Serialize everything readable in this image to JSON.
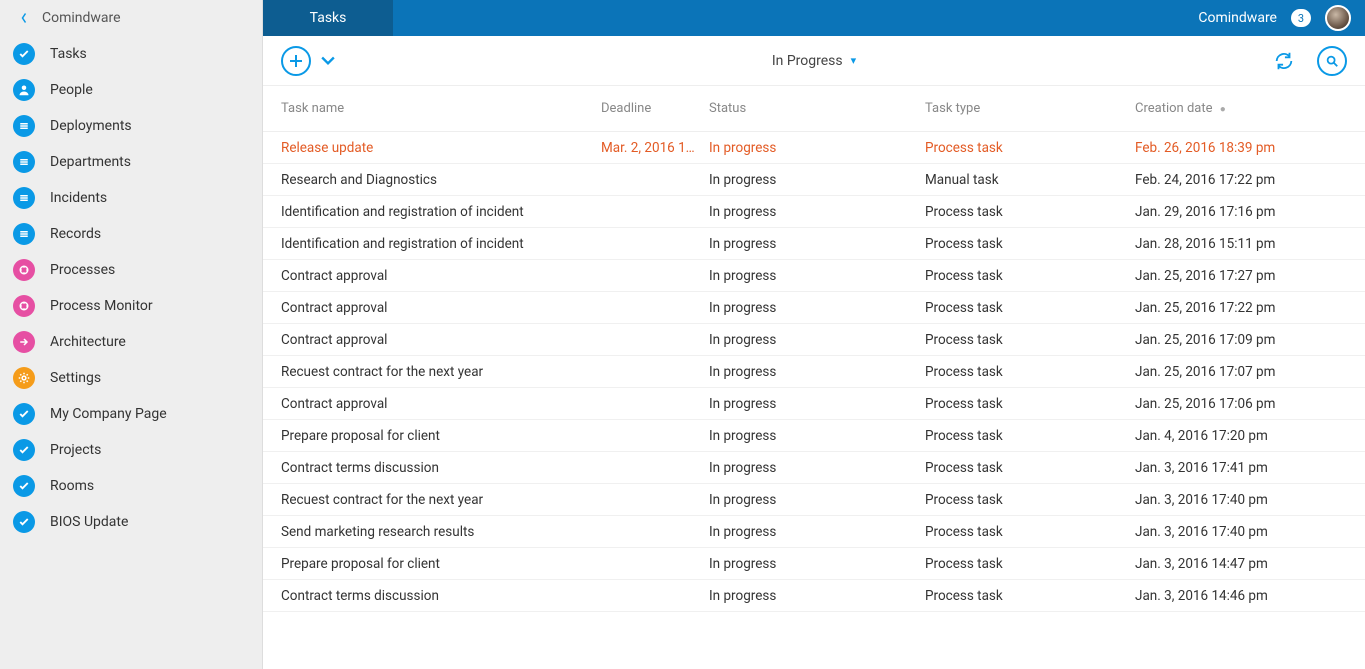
{
  "sidebar": {
    "back_label": "Comindware",
    "items": [
      {
        "label": "Tasks",
        "icon": "check",
        "color": "blue"
      },
      {
        "label": "People",
        "icon": "person",
        "color": "blue"
      },
      {
        "label": "Deployments",
        "icon": "list",
        "color": "blue"
      },
      {
        "label": "Departments",
        "icon": "list",
        "color": "blue"
      },
      {
        "label": "Incidents",
        "icon": "list",
        "color": "blue"
      },
      {
        "label": "Records",
        "icon": "list",
        "color": "blue"
      },
      {
        "label": "Processes",
        "icon": "process",
        "color": "magenta"
      },
      {
        "label": "Process Monitor",
        "icon": "process",
        "color": "magenta"
      },
      {
        "label": "Architecture",
        "icon": "arrow",
        "color": "magenta"
      },
      {
        "label": "Settings",
        "icon": "gear",
        "color": "orange"
      },
      {
        "label": "My Company Page",
        "icon": "check",
        "color": "blue"
      },
      {
        "label": "Projects",
        "icon": "check",
        "color": "blue"
      },
      {
        "label": "Rooms",
        "icon": "check",
        "color": "blue"
      },
      {
        "label": "BIOS Update",
        "icon": "check",
        "color": "blue"
      }
    ]
  },
  "header": {
    "active_tab": "Tasks",
    "brand": "Comindware",
    "badge": "3"
  },
  "toolbar": {
    "filter_label": "In Progress"
  },
  "columns": {
    "name": "Task name",
    "deadline": "Deadline",
    "status": "Status",
    "type": "Task type",
    "date": "Creation date"
  },
  "rows": [
    {
      "name": "Release update",
      "deadline": "Mar. 2, 2016 1…",
      "status": "In progress",
      "type": "Process task",
      "date": "Feb. 26, 2016 18:39 pm",
      "highlight": true
    },
    {
      "name": "Research and Diagnostics",
      "deadline": "",
      "status": "In progress",
      "type": "Manual task",
      "date": "Feb. 24, 2016 17:22 pm"
    },
    {
      "name": "Identification and registration of incident",
      "deadline": "",
      "status": "In progress",
      "type": "Process task",
      "date": "Jan. 29, 2016 17:16 pm"
    },
    {
      "name": "Identification and registration of incident",
      "deadline": "",
      "status": "In progress",
      "type": "Process task",
      "date": "Jan. 28, 2016 15:11 pm"
    },
    {
      "name": "Contract approval",
      "deadline": "",
      "status": "In progress",
      "type": "Process task",
      "date": "Jan. 25, 2016 17:27 pm"
    },
    {
      "name": "Contract approval",
      "deadline": "",
      "status": "In progress",
      "type": "Process task",
      "date": "Jan. 25, 2016 17:22 pm"
    },
    {
      "name": "Contract approval",
      "deadline": "",
      "status": "In progress",
      "type": "Process task",
      "date": "Jan. 25, 2016 17:09 pm"
    },
    {
      "name": "Recuest contract for the next year",
      "deadline": "",
      "status": "In progress",
      "type": "Process task",
      "date": "Jan. 25, 2016 17:07 pm"
    },
    {
      "name": "Contract approval",
      "deadline": "",
      "status": "In progress",
      "type": "Process task",
      "date": "Jan. 25, 2016 17:06 pm"
    },
    {
      "name": "Prepare proposal for client",
      "deadline": "",
      "status": "In progress",
      "type": "Process task",
      "date": "Jan. 4, 2016 17:20 pm"
    },
    {
      "name": "Contract terms discussion",
      "deadline": "",
      "status": "In progress",
      "type": "Process task",
      "date": "Jan. 3, 2016 17:41 pm"
    },
    {
      "name": "Recuest contract for the next year",
      "deadline": "",
      "status": "In progress",
      "type": "Process task",
      "date": "Jan. 3, 2016 17:40 pm"
    },
    {
      "name": "Send marketing research results",
      "deadline": "",
      "status": "In progress",
      "type": "Process task",
      "date": "Jan. 3, 2016 17:40 pm"
    },
    {
      "name": "Prepare proposal for client",
      "deadline": "",
      "status": "In progress",
      "type": "Process task",
      "date": "Jan. 3, 2016 14:47 pm"
    },
    {
      "name": "Contract terms discussion",
      "deadline": "",
      "status": "In progress",
      "type": "Process task",
      "date": "Jan. 3, 2016 14:46 pm"
    }
  ]
}
